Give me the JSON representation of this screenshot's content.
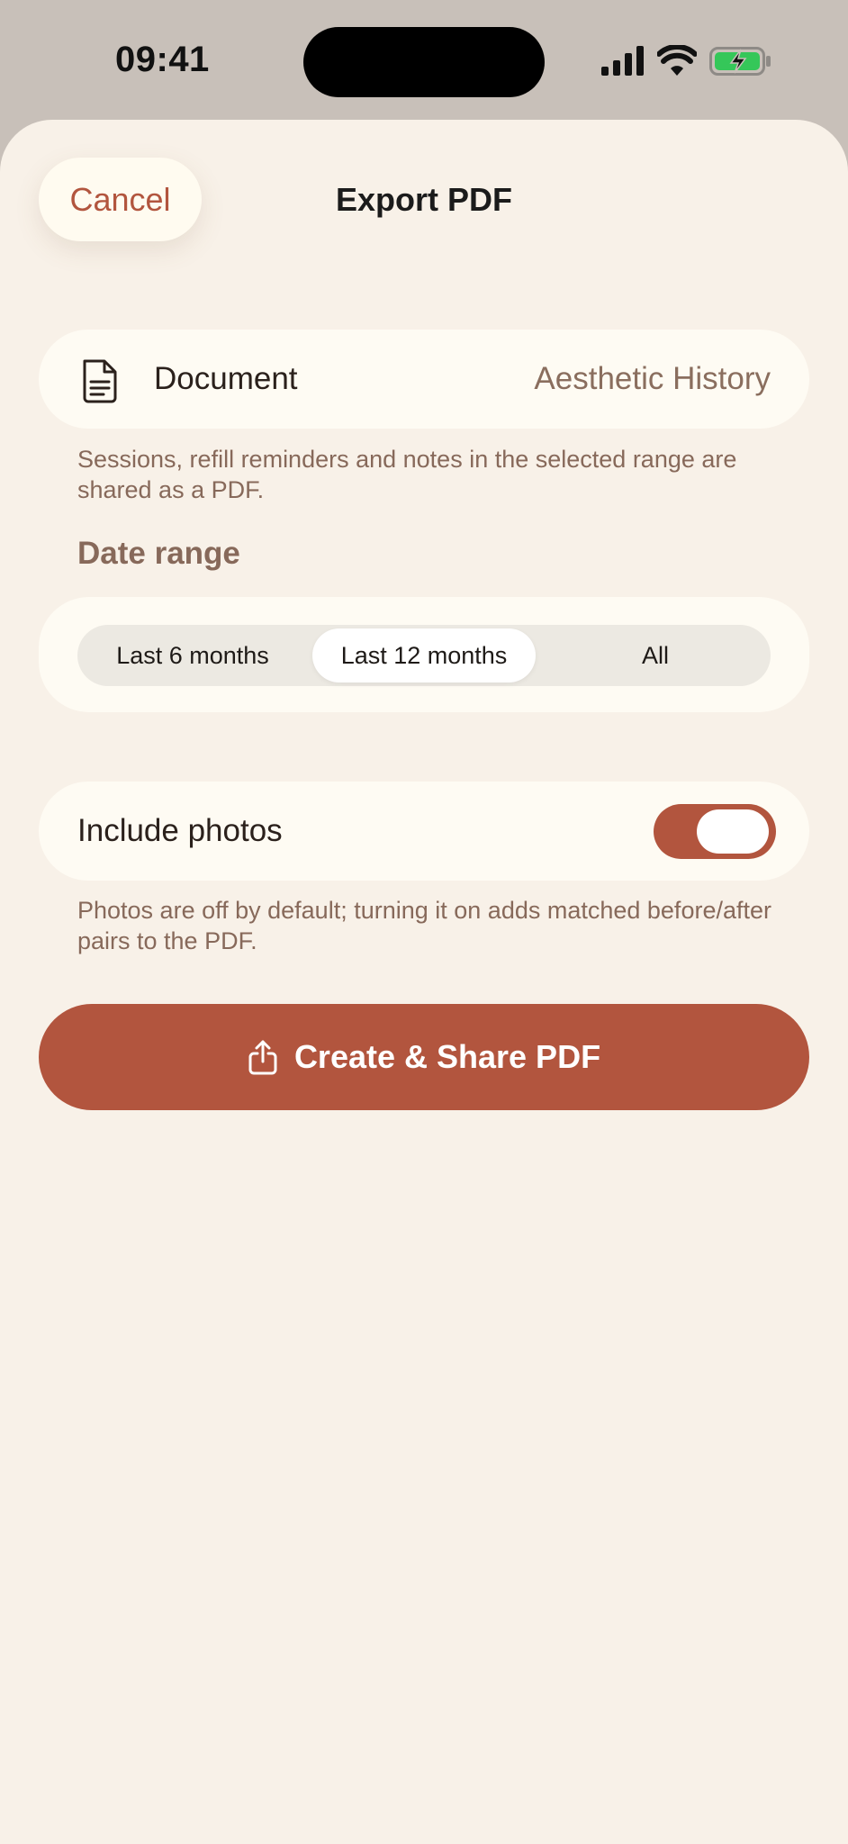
{
  "status_bar": {
    "time": "09:41",
    "icons": [
      "cellular-signal-icon",
      "wifi-icon",
      "battery-charging-icon"
    ],
    "battery_color": "#35c759"
  },
  "header": {
    "cancel_label": "Cancel",
    "title": "Export PDF"
  },
  "document": {
    "icon": "document-icon",
    "label": "Document",
    "value": "Aesthetic History",
    "footnote": "Sessions, refill reminders and notes in the selected range are shared as a PDF."
  },
  "date_range": {
    "section_label": "Date range",
    "options": [
      "Last 6 months",
      "Last 12 months",
      "All"
    ],
    "selected": "Last 12 months"
  },
  "photos": {
    "label": "Include photos",
    "enabled": true,
    "footnote": "Photos are off by default; turning it on adds matched before/after pairs to the PDF."
  },
  "primary_action": {
    "icon": "share-icon",
    "label": "Create & Share PDF"
  },
  "colors": {
    "accent": "#b2553e",
    "sheet_background": "#f8f1e8",
    "card_background": "#fefbf3",
    "secondary_text": "#87695a"
  }
}
